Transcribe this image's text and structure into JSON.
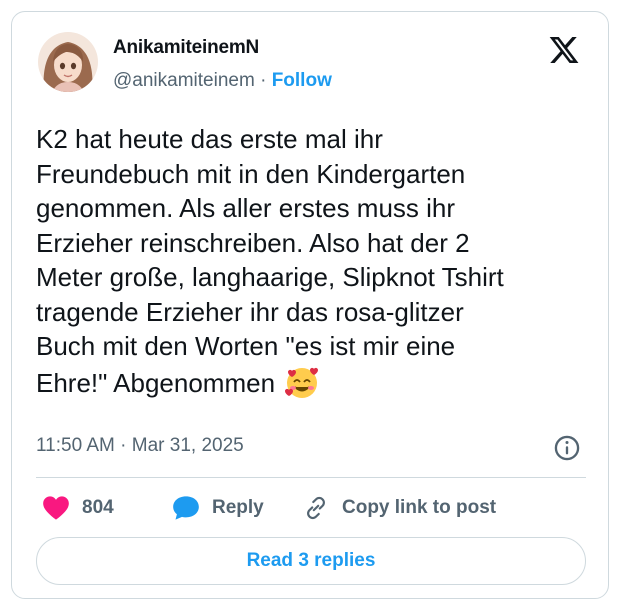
{
  "author": {
    "display_name": "AnikamiteinemN",
    "handle": "@anikamiteinem",
    "separator": "·",
    "follow_label": "Follow",
    "avatar_icon": "avatar-illustration-girl-long-hair"
  },
  "platform_icon": "x-logo",
  "tweet": {
    "lines": [
      "K2 hat heute das erste mal ihr",
      "Freundebuch mit in den Kindergarten",
      "genommen. Als aller erstes muss ihr",
      "Erzieher reinschreiben. Also hat der 2",
      "Meter große, langhaarige, Slipknot Tshirt",
      "tragende Erzieher ihr das rosa-glitzer",
      "Buch mit den Worten \"es ist mir eine",
      "Ehre!\" Abgenommen"
    ],
    "emoji": "smiling-face-with-hearts",
    "time": "11:50 AM",
    "meta_separator": "·",
    "date": "Mar 31, 2025"
  },
  "actions": {
    "like_count": "804",
    "reply_label": "Reply",
    "copy_label": "Copy link to post"
  },
  "read_replies_label": "Read 3 replies",
  "colors": {
    "accent": "#1d9bf0",
    "text": "#0f1419",
    "muted": "#536471",
    "border": "#cfd9de",
    "like": "#f91880"
  }
}
